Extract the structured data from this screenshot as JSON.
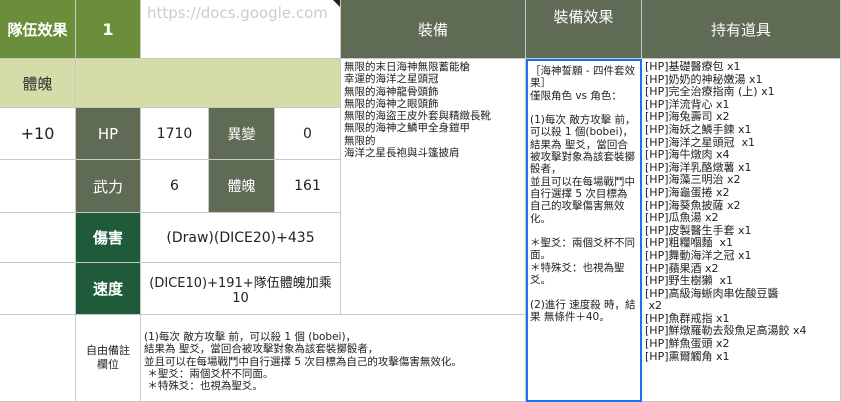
{
  "sheet": {
    "team_effect_label": "隊伍效果",
    "team_effect_value": "1",
    "url_text": "https://docs.google.com",
    "equipment_header": "裝備",
    "equip_effect_header": "裝備效果",
    "items_header": "持有道具",
    "stamina_label": "體魄",
    "plus_value": "+10",
    "stats": {
      "hp_label": "HP",
      "hp_value": "1710",
      "anomaly_label": "異變",
      "anomaly_value": "0",
      "might_label": "武力",
      "might_value": "6",
      "stamina2_label": "體魄",
      "stamina2_value": "161"
    },
    "damage_label": "傷害",
    "damage_formula": "(Draw)(DICE20)+435",
    "speed_label": "速度",
    "speed_formula": "(DICE10)+191+隊伍體魄加乘10",
    "free_note_label": "自由備註\n欄位",
    "equipment_list": "無限的末日海神無限蓄能槍\n幸運的海洋之星頭冠\n無限的海神龍骨頭飾\n無限的海神之眼頭飾\n無限的海盜王皮外套與精緻長靴\n無限的海神之鱗甲全身鎧甲\n無限的\n海洋之星長袍與斗篷披肩",
    "equip_effect_text": "［海神誓願 - 四件套效果］\n僅限角色 vs 角色：\n\n(1)每次 敵方攻擊 前，可以殺 1 個(bobei)，\n結果為 聖爻，當回合被攻擊對象為該套裝擲骰者，\n並且可以在每場戰鬥中自行選擇 5 次目標為自己的攻擊傷害無效化。\n\n＊聖爻：兩個爻杯不同面。\n＊特殊爻：也視為聖爻。\n\n(2)進行 速度殺 時，結果 無條件＋40。",
    "free_note_text": "(1)每次 敵方攻擊 前，可以殺 1 個 (bobei)，\n結果為 聖爻，當回合被攻擊對象為該套裝擲骰者，\n並且可以在每場戰鬥中自行選擇 5 次目標為自己的攻擊傷害無效化。\n ＊聖爻：兩個爻杯不同面。\n ＊特殊爻：也視為聖爻。",
    "items_list": "[HP]基礎醫療包 x1\n[HP]奶奶的神秘嫩湯 x1\n[HP]完全治療指南 (上) x1\n[HP]洋流背心 x1\n[HP]海兔壽司 x2\n[HP]海妖之鱗手鍊 x1\n[HP]海洋之星頭冠  x1\n[HP]海牛燉肉 x4\n[HP]海洋乳酪燉薯 x1\n[HP]海藻三明治 x2\n[HP]海龜蛋捲 x2\n[HP]海葵魚披薩 x2\n[HP]瓜魚湯 x2\n[HP]皮製醫生手套 x1\n[HP]粗糧嗰麵  x1\n[HP]舞動海洋之冠 x1\n[HP]蘋果酒 x2\n[HP]野生樹獺  x1\n[HP]高級海蜥肉串佐酸豆醬\n x2\n[HP]魚群戒指 x1\n[HP]鮮燉羅勒去殼魚足高湯餃 x4\n[HP]鮮魚蛋頭 x2\n[HP]熏爾觸角 x1"
  }
}
